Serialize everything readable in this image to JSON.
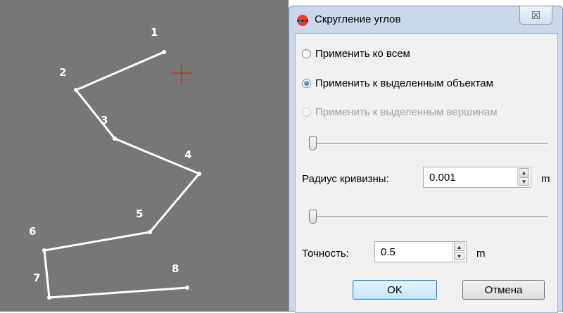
{
  "canvas": {
    "vertices": [
      {
        "label": "1"
      },
      {
        "label": "2"
      },
      {
        "label": "3"
      },
      {
        "label": "4"
      },
      {
        "label": "5"
      },
      {
        "label": "6"
      },
      {
        "label": "7"
      },
      {
        "label": "8"
      }
    ]
  },
  "dialog": {
    "title": "Скругление углов",
    "close_glyph": "☒",
    "options": {
      "apply_all": "Применить ко всем",
      "apply_selected_objects": "Применить к выделенным объектам",
      "apply_selected_vertices": "Применить к выделенным вершинам",
      "selected": "apply_selected_objects"
    },
    "radius": {
      "label": "Радиус кривизны:",
      "value": "0.001",
      "unit": "m",
      "slider_level": 0
    },
    "precision": {
      "label": "Точность:",
      "value": "0.5",
      "unit": "m"
    },
    "top_slider_level": 0,
    "ok_label": "OK",
    "cancel_label": "Отмена"
  },
  "colors": {
    "canvas_bg": "#777777",
    "polyline": "#ffffff",
    "cursor": "#e02020",
    "dialog_frame": "#c9d8ea",
    "ok_border": "#3c7fb1"
  },
  "icons": {
    "app": "3d-glasses-icon",
    "close": "close-icon",
    "cursor": "crosshair-cursor-icon",
    "spin_up": "spin-up-icon",
    "spin_down": "spin-down-icon"
  }
}
